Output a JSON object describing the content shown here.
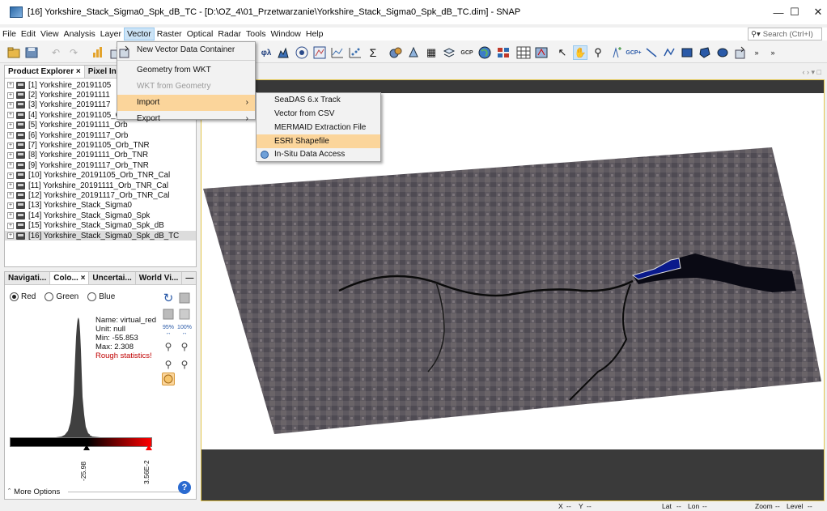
{
  "window": {
    "title": "[16] Yorkshire_Stack_Sigma0_Spk_dB_TC - [D:\\OZ_4\\01_Przetwarzanie\\Yorkshire_Stack_Sigma0_Spk_dB_TC.dim] - SNAP",
    "minimize": "—",
    "maximize": "☐",
    "close": "✕"
  },
  "menu": [
    "File",
    "Edit",
    "View",
    "Analysis",
    "Layer",
    "Vector",
    "Raster",
    "Optical",
    "Radar",
    "Tools",
    "Window",
    "Help"
  ],
  "search": {
    "placeholder": "Search (Ctrl+I)",
    "icon": "search-icon"
  },
  "vector_menu": {
    "items": [
      {
        "label": "New Vector Data Container",
        "enabled": true
      },
      {
        "label": "Geometry from WKT",
        "enabled": true
      },
      {
        "label": "WKT from Geometry",
        "enabled": false
      },
      {
        "label": "Import",
        "enabled": true,
        "submenu": true,
        "highlighted": true
      },
      {
        "label": "Export",
        "enabled": true,
        "submenu": true
      }
    ]
  },
  "import_submenu": {
    "items": [
      {
        "label": "SeaDAS 6.x Track"
      },
      {
        "label": "Vector from CSV"
      },
      {
        "label": "MERMAID Extraction File"
      },
      {
        "label": "ESRI Shapefile",
        "highlighted": true
      },
      {
        "label": "In-Situ Data Access"
      }
    ]
  },
  "product_explorer": {
    "tabs": [
      "Product Explorer ×",
      "Pixel Info"
    ],
    "products": [
      "[1] Yorkshire_20191105",
      "[2] Yorkshire_20191111",
      "[3] Yorkshire_20191117",
      "[4] Yorkshire_20191105_Orb",
      "[5] Yorkshire_20191111_Orb",
      "[6] Yorkshire_20191117_Orb",
      "[7] Yorkshire_20191105_Orb_TNR",
      "[8] Yorkshire_20191111_Orb_TNR",
      "[9] Yorkshire_20191117_Orb_TNR",
      "[10] Yorkshire_20191105_Orb_TNR_Cal",
      "[11] Yorkshire_20191111_Orb_TNR_Cal",
      "[12] Yorkshire_20191117_Orb_TNR_Cal",
      "[13] Yorkshire_Stack_Sigma0",
      "[14] Yorkshire_Stack_Sigma0_Spk",
      "[15] Yorkshire_Stack_Sigma0_Spk_dB",
      "[16] Yorkshire_Stack_Sigma0_Spk_dB_TC"
    ],
    "selected_index": 15
  },
  "color_panel": {
    "tabs": [
      "Navigati...",
      "Colo... ×",
      "Uncertai...",
      "World Vi..."
    ],
    "minimize": "—",
    "channels": [
      "Red",
      "Green",
      "Blue"
    ],
    "selected_channel": "Red",
    "stats": {
      "name": "Name: virtual_red",
      "unit": "Unit: null",
      "min": "Min: -55.853",
      "max": "Max: 2.308",
      "note": "Rough statistics!"
    },
    "slider_min": "-25.98",
    "slider_max": "3.56E-2",
    "percent_95": "95%",
    "percent_100": "100%",
    "more_options": "More Options",
    "note_color": "#c00000"
  },
  "statusbar": {
    "x": "X",
    "x_val": "--",
    "y": "Y",
    "y_val": "--",
    "lat": "Lat",
    "lat_val": "--",
    "lon": "Lon",
    "lon_val": "--",
    "zoom": "Zoom",
    "zoom_val": "--",
    "level": "Level",
    "level_val": "--"
  },
  "colors": {
    "menu_highlight": "#fbd59b",
    "selection": "#cce4f7",
    "river_blue": "#0a1a8c"
  }
}
